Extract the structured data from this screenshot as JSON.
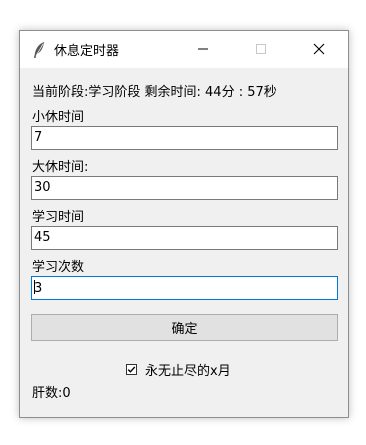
{
  "window": {
    "title": "休息定时器"
  },
  "status": {
    "text": "当前阶段:学习阶段  剩余时间:  44分 : 57秒"
  },
  "fields": {
    "short_break": {
      "label": "小休时间",
      "value": "7"
    },
    "long_break": {
      "label": "大休时间:",
      "value": "30"
    },
    "study_time": {
      "label": "学习时间",
      "value": "45"
    },
    "study_count": {
      "label": "学习次数",
      "value": "3"
    }
  },
  "confirm": {
    "label": "确定"
  },
  "forever": {
    "label": "永无止尽的x月",
    "checked": true
  },
  "counter": {
    "text": "肝数:0"
  }
}
